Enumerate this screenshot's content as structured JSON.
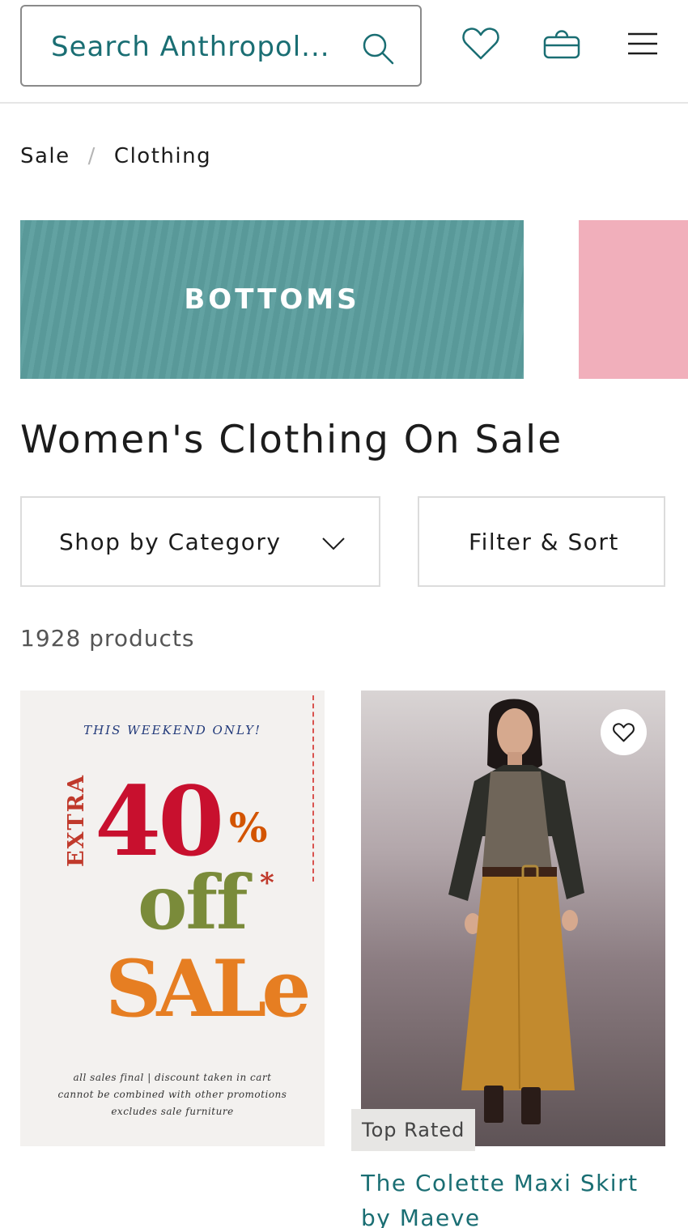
{
  "header": {
    "search_text": "Search Anthropol...",
    "icons": [
      "search-icon",
      "heart-icon",
      "bag-icon",
      "menu-icon"
    ]
  },
  "breadcrumb": {
    "items": [
      "Sale",
      "Clothing"
    ],
    "separator": "/"
  },
  "banner": {
    "label": "BOTTOMS",
    "color": "#5c9e9e",
    "next_color": "#f1afbb"
  },
  "page": {
    "title": "Women's Clothing On Sale",
    "category_button": "Shop by Category",
    "filter_button": "Filter & Sort",
    "product_count": "1928 products"
  },
  "promo": {
    "top_line": "THIS WEEKEND ONLY!",
    "extra": "EXTRA",
    "percent": "40",
    "percent_sign": "%",
    "off": "off",
    "asterisk": "*",
    "sale": "SALe",
    "fine_print": [
      "all sales final | discount taken in cart",
      "cannot be combined with other promotions",
      "excludes sale furniture"
    ]
  },
  "product": {
    "badge": "Top Rated",
    "name": "The Colette Maxi Skirt by Maeve"
  },
  "colors": {
    "brand_teal": "#1a6e73"
  }
}
